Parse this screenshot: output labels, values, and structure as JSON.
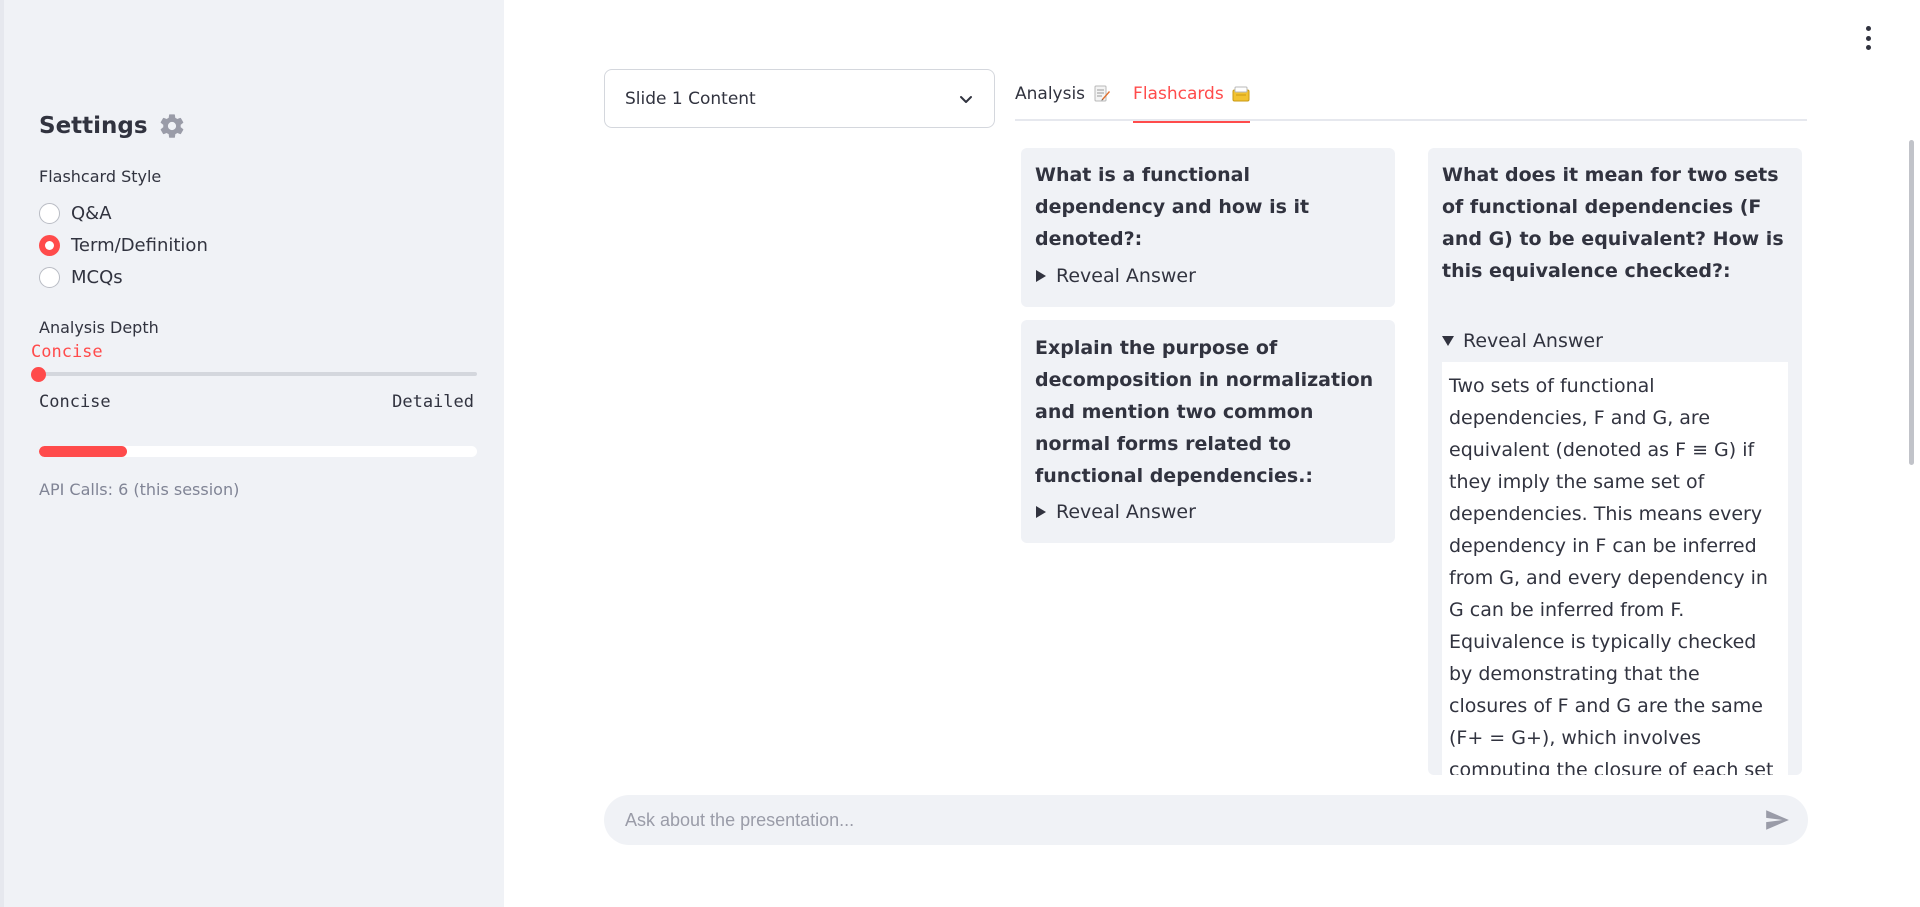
{
  "sidebar": {
    "title": "Settings",
    "flashcard_style_label": "Flashcard Style",
    "style_options": [
      "Q&A",
      "Term/Definition",
      "MCQs"
    ],
    "style_selected": "Term/Definition",
    "analysis_depth_label": "Analysis Depth",
    "depth_value": "Concise",
    "depth_min_label": "Concise",
    "depth_max_label": "Detailed",
    "api_progress": 0.2,
    "api_calls_text": "API Calls: 6 (this session)"
  },
  "main": {
    "slide_select": {
      "value": "Slide 1 Content"
    },
    "tabs": [
      {
        "label": "Analysis",
        "icon": "memo-icon",
        "active": false
      },
      {
        "label": "Flashcards",
        "icon": "card-index-icon",
        "active": true
      }
    ],
    "cards": [
      {
        "question": "What is a functional dependency and how is it denoted?:",
        "reveal_label": "Reveal Answer",
        "expanded": false
      },
      {
        "question": "Explain the purpose of decomposition in normalization and mention two common normal forms related to functional dependencies.:",
        "reveal_label": "Reveal Answer",
        "expanded": false
      },
      {
        "question": "What does it mean for two sets of functional dependencies (F and G) to be equivalent? How is this equivalence checked?:",
        "reveal_label": "Reveal Answer",
        "expanded": true,
        "answer": "Two sets of functional dependencies, F and G, are equivalent (denoted as F ≡ G) if they imply the same set of dependencies. This means every dependency in F can be inferred from G, and every dependency in G can be inferred from F. Equivalence is typically checked by demonstrating that the closures of F and G are the same (F+ = G+), which involves computing the closure of each set by applying Armstrong's axioms (reflexivity, augmentation, and transitivity)."
      }
    ],
    "chat": {
      "placeholder": "Ask about the presentation..."
    }
  },
  "colors": {
    "accent": "#ff4b4b",
    "sidebar_bg": "#f0f2f6",
    "text": "#31333f",
    "muted": "#808495"
  }
}
